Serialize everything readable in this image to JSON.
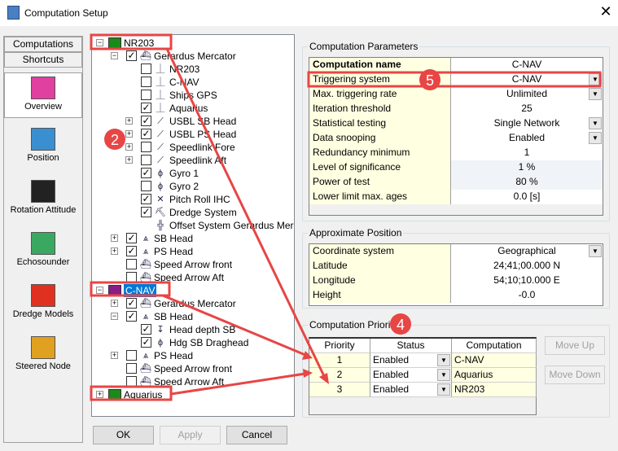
{
  "window": {
    "title": "Computation Setup",
    "close": "✕"
  },
  "sidebar": {
    "tabs": [
      "Computations",
      "Shortcuts"
    ],
    "items": [
      {
        "label": "Overview",
        "icon": "overview-icon"
      },
      {
        "label": "Position",
        "icon": "position-icon"
      },
      {
        "label": "Rotation Attitude",
        "icon": "rotation-attitude-icon"
      },
      {
        "label": "Echosounder",
        "icon": "echosounder-icon"
      },
      {
        "label": "Dredge Models",
        "icon": "dredge-models-icon"
      },
      {
        "label": "Steered Node",
        "icon": "steered-node-icon"
      }
    ]
  },
  "tree": [
    {
      "label": "NR203",
      "level": 0,
      "exp": "-",
      "icon": "computation-icon",
      "color": "#1a8a1a"
    },
    {
      "label": "Gerardus Mercator",
      "level": 1,
      "exp": "-",
      "checked": true,
      "icon": "vessel-icon"
    },
    {
      "label": "NR203",
      "level": 2,
      "checked": false,
      "icon": "antenna-icon"
    },
    {
      "label": "C-NAV",
      "level": 2,
      "checked": false,
      "icon": "antenna-icon"
    },
    {
      "label": "Ships GPS",
      "level": 2,
      "checked": false,
      "icon": "antenna-icon"
    },
    {
      "label": "Aquarius",
      "level": 2,
      "checked": true,
      "icon": "antenna-icon"
    },
    {
      "label": "USBL SB Head",
      "level": 2,
      "exp": "+",
      "checked": true,
      "icon": "usbl-icon"
    },
    {
      "label": "USBL PS Head",
      "level": 2,
      "exp": "+",
      "checked": true,
      "icon": "usbl-icon"
    },
    {
      "label": "Speedlink Fore",
      "level": 2,
      "exp": "+",
      "checked": false,
      "icon": "speedlink-icon"
    },
    {
      "label": "Speedlink Aft",
      "level": 2,
      "exp": "+",
      "checked": false,
      "icon": "speedlink-icon"
    },
    {
      "label": "Gyro 1",
      "level": 2,
      "checked": true,
      "icon": "gyro-icon"
    },
    {
      "label": "Gyro 2",
      "level": 2,
      "checked": false,
      "icon": "gyro-icon"
    },
    {
      "label": "Pitch Roll IHC",
      "level": 2,
      "checked": true,
      "icon": "pitch-roll-icon"
    },
    {
      "label": "Dredge System",
      "level": 2,
      "checked": true,
      "icon": "dredge-icon"
    },
    {
      "label": "Offset System Gerardus Mercator",
      "level": 2,
      "icon": "offset-icon"
    },
    {
      "label": "SB Head",
      "level": 1,
      "exp": "+",
      "checked": true,
      "icon": "head-icon"
    },
    {
      "label": "PS Head",
      "level": 1,
      "exp": "+",
      "checked": true,
      "icon": "head-icon"
    },
    {
      "label": "Speed Arrow front",
      "level": 1,
      "checked": false,
      "icon": "vessel-icon"
    },
    {
      "label": "Speed Arrow Aft",
      "level": 1,
      "checked": false,
      "icon": "vessel-icon"
    },
    {
      "label": "C-NAV",
      "level": 0,
      "exp": "-",
      "icon": "computation-icon",
      "color": "#8a1a8a",
      "selected": true
    },
    {
      "label": "Gerardus Mercator",
      "level": 1,
      "exp": "+",
      "checked": true,
      "icon": "vessel-icon"
    },
    {
      "label": "SB Head",
      "level": 1,
      "exp": "-",
      "checked": true,
      "icon": "head-icon"
    },
    {
      "label": "Head depth SB",
      "level": 2,
      "checked": true,
      "icon": "depth-icon"
    },
    {
      "label": "Hdg SB Draghead",
      "level": 2,
      "checked": true,
      "icon": "gyro-icon"
    },
    {
      "label": "PS Head",
      "level": 1,
      "exp": "+",
      "checked": false,
      "icon": "head-icon"
    },
    {
      "label": "Speed Arrow front",
      "level": 1,
      "checked": false,
      "icon": "vessel-icon"
    },
    {
      "label": "Speed Arrow Aft",
      "level": 1,
      "checked": false,
      "icon": "vessel-icon"
    },
    {
      "label": "Aquarius",
      "level": 0,
      "exp": "+",
      "icon": "computation-icon",
      "color": "#1a8a1a"
    }
  ],
  "params": {
    "title": "Computation Parameters",
    "rows": [
      {
        "key": "Computation name",
        "value": "C-NAV",
        "bold": true
      },
      {
        "key": "Triggering system",
        "value": "C-NAV",
        "dropdown": true
      },
      {
        "key": "Max. triggering rate",
        "value": "Unlimited",
        "dropdown": true
      },
      {
        "key": "Iteration threshold",
        "value": "25"
      },
      {
        "key": "Statistical testing",
        "value": "Single Network",
        "dropdown": true
      },
      {
        "key": "Data snooping",
        "value": "Enabled",
        "dropdown": true
      },
      {
        "key": "Redundancy minimum",
        "value": "1"
      },
      {
        "key": "Level of significance",
        "value": "1 %",
        "shaded": true
      },
      {
        "key": "Power of test",
        "value": "80 %",
        "shaded": true
      },
      {
        "key": "Lower limit max. ages",
        "value": "0.0 [s]"
      }
    ]
  },
  "position": {
    "title": "Approximate Position",
    "rows": [
      {
        "key": "Coordinate system",
        "value": "Geographical",
        "dropdown": true
      },
      {
        "key": "Latitude",
        "value": "24;41;00.000 N"
      },
      {
        "key": "Longitude",
        "value": "54;10;10.000 E"
      },
      {
        "key": "Height",
        "value": "-0.0"
      }
    ]
  },
  "priority": {
    "title": "Computation Priority",
    "headers": [
      "Priority",
      "Status",
      "Computation"
    ],
    "rows": [
      {
        "priority": "1",
        "status": "Enabled",
        "computation": "C-NAV"
      },
      {
        "priority": "2",
        "status": "Enabled",
        "computation": "Aquarius"
      },
      {
        "priority": "3",
        "status": "Enabled",
        "computation": "NR203"
      }
    ],
    "move_up": "Move Up",
    "move_down": "Move Down"
  },
  "buttons": {
    "ok": "OK",
    "apply": "Apply",
    "cancel": "Cancel"
  },
  "annotations": {
    "color": "#e84545",
    "badges": [
      "2",
      "4",
      "5"
    ]
  }
}
